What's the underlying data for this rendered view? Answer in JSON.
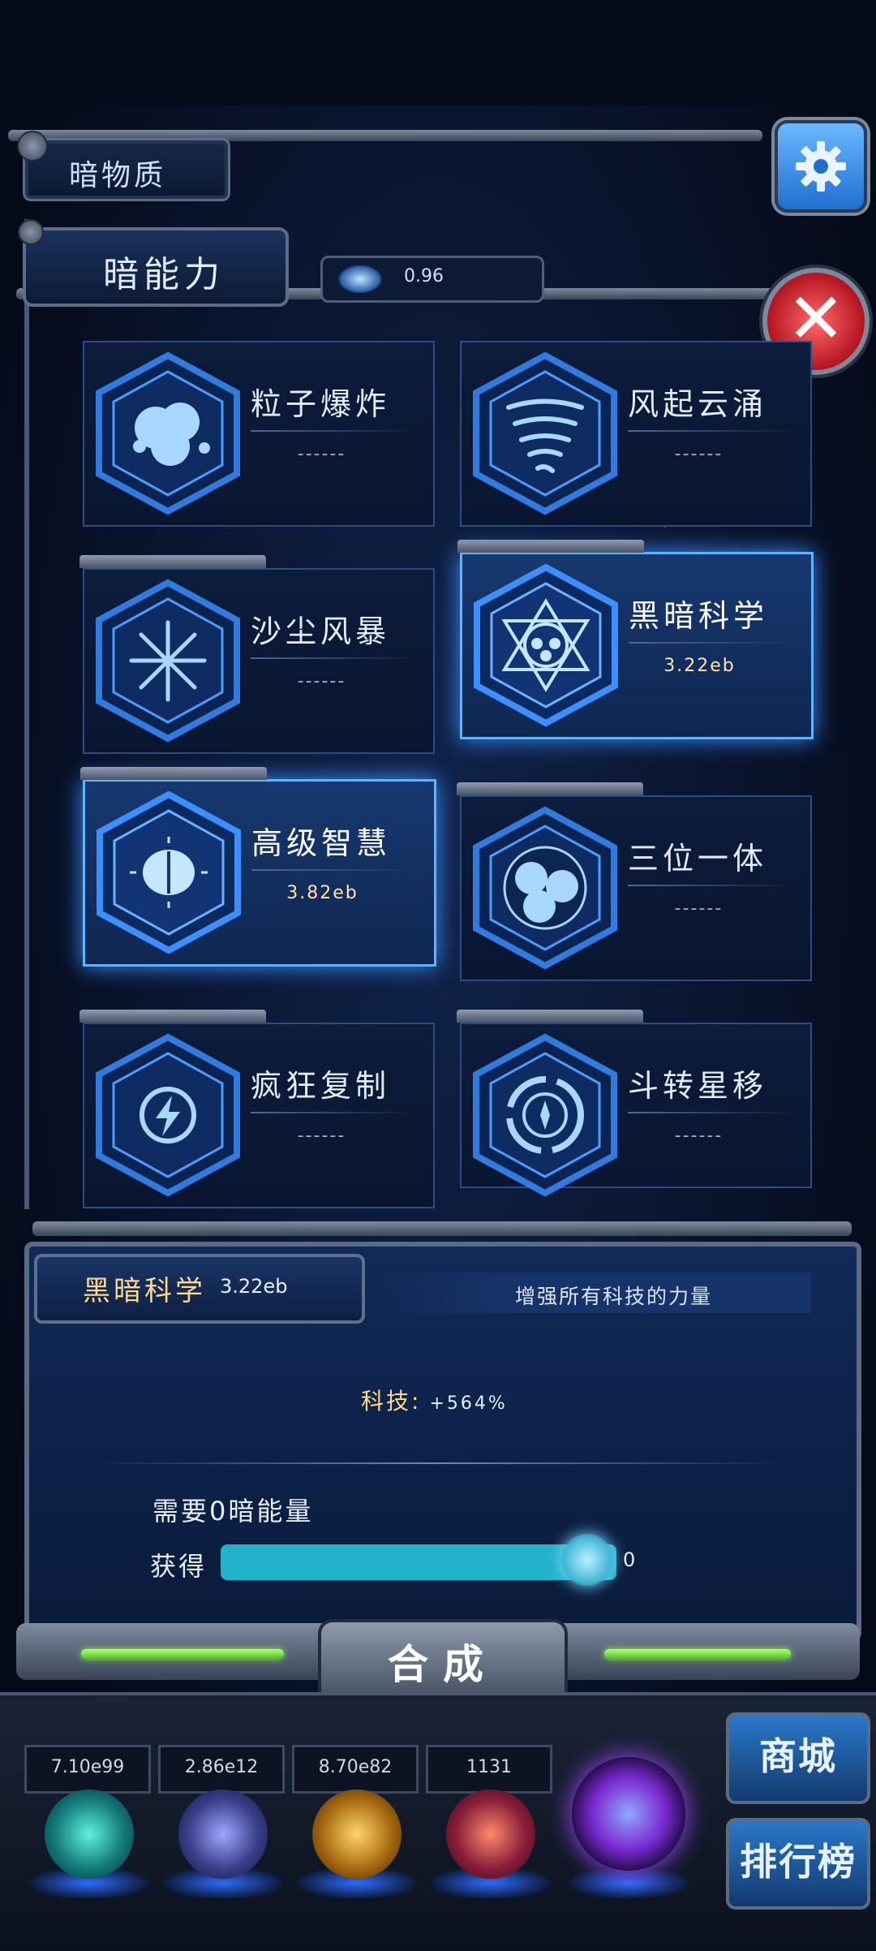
{
  "header": {
    "title": "暗物质",
    "settings_icon": "gear-icon"
  },
  "panel": {
    "title": "暗能力",
    "energy_value": "0.96",
    "close_icon": "close-icon",
    "close_label": "✕"
  },
  "abilities": [
    {
      "name": "粒子爆炸",
      "value": "------",
      "icon": "particle-explosion-icon",
      "selected": false
    },
    {
      "name": "风起云涌",
      "value": "------",
      "icon": "tornado-icon",
      "selected": false
    },
    {
      "name": "沙尘风暴",
      "value": "------",
      "icon": "sandstorm-icon",
      "selected": false
    },
    {
      "name": "黑暗科学",
      "value": "3.22eb",
      "icon": "hexagram-icon",
      "selected": true
    },
    {
      "name": "高级智慧",
      "value": "3.82eb",
      "icon": "brain-icon",
      "selected": true
    },
    {
      "name": "三位一体",
      "value": "------",
      "icon": "trinity-icon",
      "selected": false
    },
    {
      "name": "疯狂复制",
      "value": "------",
      "icon": "lightning-icon",
      "selected": false
    },
    {
      "name": "斗转星移",
      "value": "------",
      "icon": "vortex-icon",
      "selected": false
    }
  ],
  "detail": {
    "name": "黑暗科学",
    "value": "3.22eb",
    "description": "增强所有科技的力量",
    "stat_label": "科技:",
    "stat_value": "+564%",
    "need_text": "需要0暗能量",
    "gain_label": "获得",
    "gain_value": "0",
    "gain_fraction": 1.0
  },
  "combine_button": "合成",
  "resources": [
    "7.10e99",
    "2.86e12",
    "8.70e82",
    "1131"
  ],
  "side_buttons": {
    "shop": "商城",
    "rank": "排行榜"
  },
  "colors": {
    "accent": "#21b3c8",
    "selected_glow": "#3d8eff",
    "detail_name": "#ffd98a",
    "close": "#b3141f"
  }
}
